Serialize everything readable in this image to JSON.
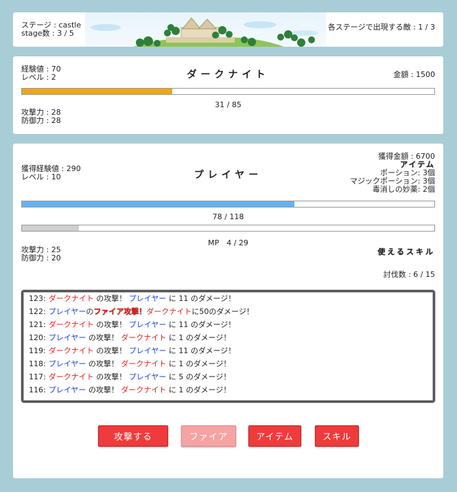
{
  "stage": {
    "name_line": "ステージ : castle",
    "count_line": "stage数 : 3 / 5",
    "enemies_line": "各ステージで出現する敵 : 1 / 3"
  },
  "enemy": {
    "name": "ダークナイト",
    "exp_line": "経験値 : 70",
    "level_line": "レベル : 2",
    "gold_line": "金額 : 1500",
    "hp_text": "31 / 85",
    "hp_fraction": 0.365,
    "hp_color": "#f7a50a",
    "attack_line": "攻撃力 : 28",
    "defense_line": "防御力 : 28"
  },
  "player": {
    "name": "プレイヤー",
    "exp_line": "獲得経験値 : 290",
    "level_line": "レベル : 10",
    "gold_line": "獲得金額 : 6700",
    "item_head": "アイテム",
    "items": [
      "ポーション: 3個",
      "マジックポーション: 3個",
      "毒消しの妙薬: 2個"
    ],
    "hp_text": "78 / 118",
    "hp_fraction": 0.661,
    "hp_color": "#64b2f0",
    "mp_text": "MP　4 / 29",
    "mp_fraction": 0.138,
    "mp_color": "#cfcfcf",
    "attack_line": "攻撃力 : 25",
    "defense_line": "防御力 : 20",
    "skill_head": "使えるスキル",
    "kills_line": "討伐数 : 6 / 15"
  },
  "log": [
    {
      "no": "123:",
      "a": "ダークナイト",
      "ac": "red",
      "m": " の攻撃！ ",
      "b": "プレイヤー",
      "bc": "blue",
      "e": " に 11 のダメージ！"
    },
    {
      "no": "122:",
      "a": "プレイヤー",
      "ac": "blue",
      "m": "の",
      "fire": "ファイア攻撃！",
      "b": "ダークナイト",
      "bc": "red",
      "e": "に50のダメージ！"
    },
    {
      "no": "121:",
      "a": "ダークナイト",
      "ac": "red",
      "m": " の攻撃！ ",
      "b": "プレイヤー",
      "bc": "blue",
      "e": " に 11 のダメージ！"
    },
    {
      "no": "120:",
      "a": "プレイヤー",
      "ac": "blue",
      "m": " の攻撃！ ",
      "b": "ダークナイト",
      "bc": "red",
      "e": " に 1 のダメージ！"
    },
    {
      "no": "119:",
      "a": "ダークナイト",
      "ac": "red",
      "m": " の攻撃！ ",
      "b": "プレイヤー",
      "bc": "blue",
      "e": " に 11 のダメージ！"
    },
    {
      "no": "118:",
      "a": "プレイヤー",
      "ac": "blue",
      "m": " の攻撃！ ",
      "b": "ダークナイト",
      "bc": "red",
      "e": " に 1 のダメージ！"
    },
    {
      "no": "117:",
      "a": "ダークナイト",
      "ac": "red",
      "m": " の攻撃！ ",
      "b": "プレイヤー",
      "bc": "blue",
      "e": " に 5 のダメージ！"
    },
    {
      "no": "116:",
      "a": "プレイヤー",
      "ac": "blue",
      "m": " の攻撃！ ",
      "b": "ダークナイト",
      "bc": "red",
      "e": " に 1 のダメージ！"
    }
  ],
  "buttons": {
    "attack": "攻撃する",
    "fire": "ファイア",
    "item": "アイテム",
    "skill": "スキル"
  }
}
